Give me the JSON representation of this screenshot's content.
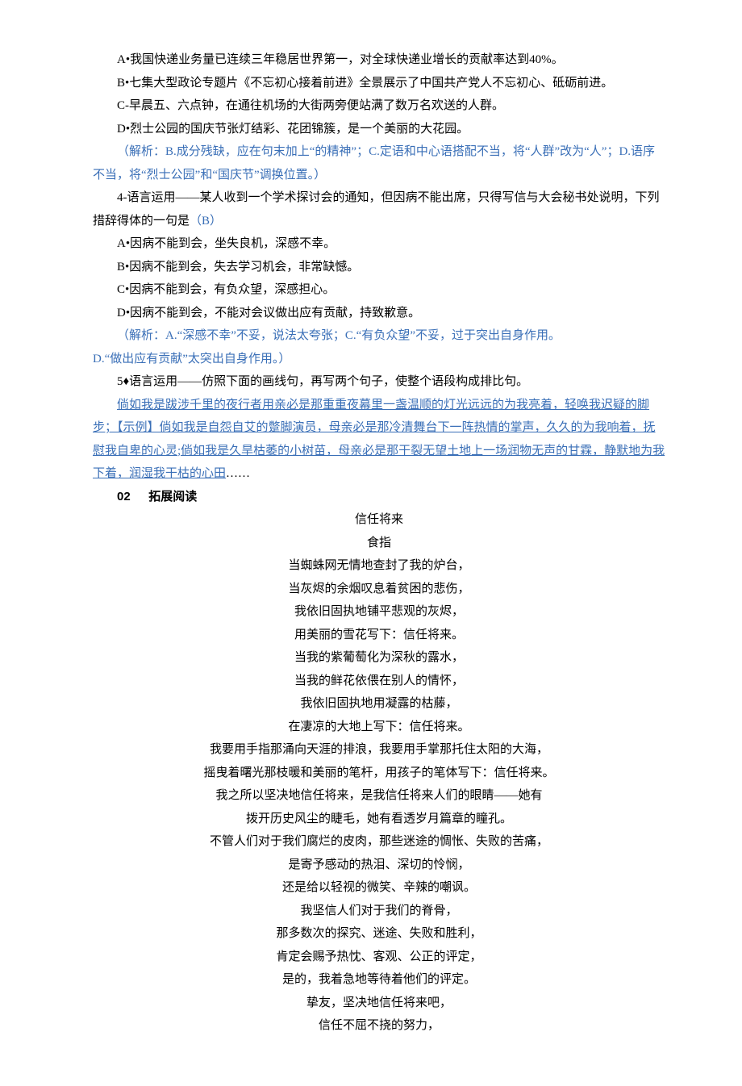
{
  "q3": {
    "optA": "A•我国快递业务量已连续三年稳居世界第一，对全球快递业增长的贡献率达到40%。",
    "optB": "B•七集大型政论专题片《不忘初心接着前进》全景展示了中国共产党人不忘初心、砥砺前进。",
    "optC": "C-早晨五、六点钟，在通往机场的大街两旁便站满了数万名欢送的人群。",
    "optD": "D•烈士公园的国庆节张灯结彩、花团锦簇，是一个美丽的大花园。",
    "analysis": "（解析：B.成分残缺，应在句末加上“的精神”；C.定语和中心语搭配不当，将“人群”改为“人”；D.语序不当，将“烈士公园”和“国庆节”调换位置。）"
  },
  "q4": {
    "stem1": "4-语言运用——某人收到一个学术探讨会的通知，但因病不能出席，只得写信与大会秘书处说明，下列措辞得体的一句是",
    "answer": "（B）",
    "optA": "A•因病不能到会，坐失良机，深感不幸。",
    "optB": "B•因病不能到会，失去学习机会，非常缺憾。",
    "optC": "C•因病不能到会，有负众望，深感担心。",
    "optD": "D•因病不能到会，不能对会议做出应有贡献，持致歉意。",
    "analysis1": "（解析：A.“深感不幸”不妥，说法太夸张；C.“有负众望”不妥，过于突出自身作用。",
    "analysis2": "D.“做出应有贡献”太突出自身作用。）"
  },
  "q5": {
    "stem": "5♦语言运用——仿照下面的画线句，再写两个句子，使整个语段构成排比句。",
    "example": "倘如我是跋涉千里的夜行者用亲必是那重重夜幕里一盏温顺的灯光远远的为我亮着，轻唤我迟疑的脚步；【示例】倘如我是自怨自艾的蹩脚演员，母亲必是那冷清舞台下一阵热情的掌声，久久的为我响着，抚慰我自卑的心灵;倘如我是久旱枯萎的小树苗，母亲必是那干裂无望土地上一场润物无声的甘霖，静默地为我下着，润湿我干枯的心田",
    "tail": "……"
  },
  "section02": {
    "num": "02",
    "title": "拓展阅读"
  },
  "poem": {
    "title": "信任将来",
    "author": "食指",
    "lines": [
      "当蜘蛛网无情地查封了我的炉台，",
      "当灰烬的余烟叹息着贫困的悲伤，",
      "我依旧固执地铺平悲观的灰烬，",
      "用美丽的雪花写下：信任将来。",
      "当我的紫葡萄化为深秋的露水，",
      "当我的鲜花依偎在别人的情怀，",
      "我依旧固执地用凝露的枯藤，",
      "在凄凉的大地上写下：信任将来。",
      "我要用手指那涌向天涯的排浪，我要用手掌那托住太阳的大海，",
      "摇曳着曙光那枝暖和美丽的笔杆，用孩子的笔体写下：信任将来。",
      "我之所以坚决地信任将来，是我信任将来人们的眼睛——她有",
      "拨开历史风尘的睫毛，她有看透岁月篇章的瞳孔。",
      "不管人们对于我们腐烂的皮肉，那些迷途的惆怅、失败的苦痛，",
      "是寄予感动的热泪、深切的怜悯，",
      "还是给以轻视的微笑、辛辣的嘲讽。",
      "我坚信人们对于我们的脊骨，",
      "那多数次的探究、迷途、失败和胜利，",
      "肯定会赐予热忱、客观、公正的评定，",
      "是的，我着急地等待着他们的评定。",
      "挚友，坚决地信任将来吧，",
      "信任不屈不挠的努力，"
    ]
  }
}
